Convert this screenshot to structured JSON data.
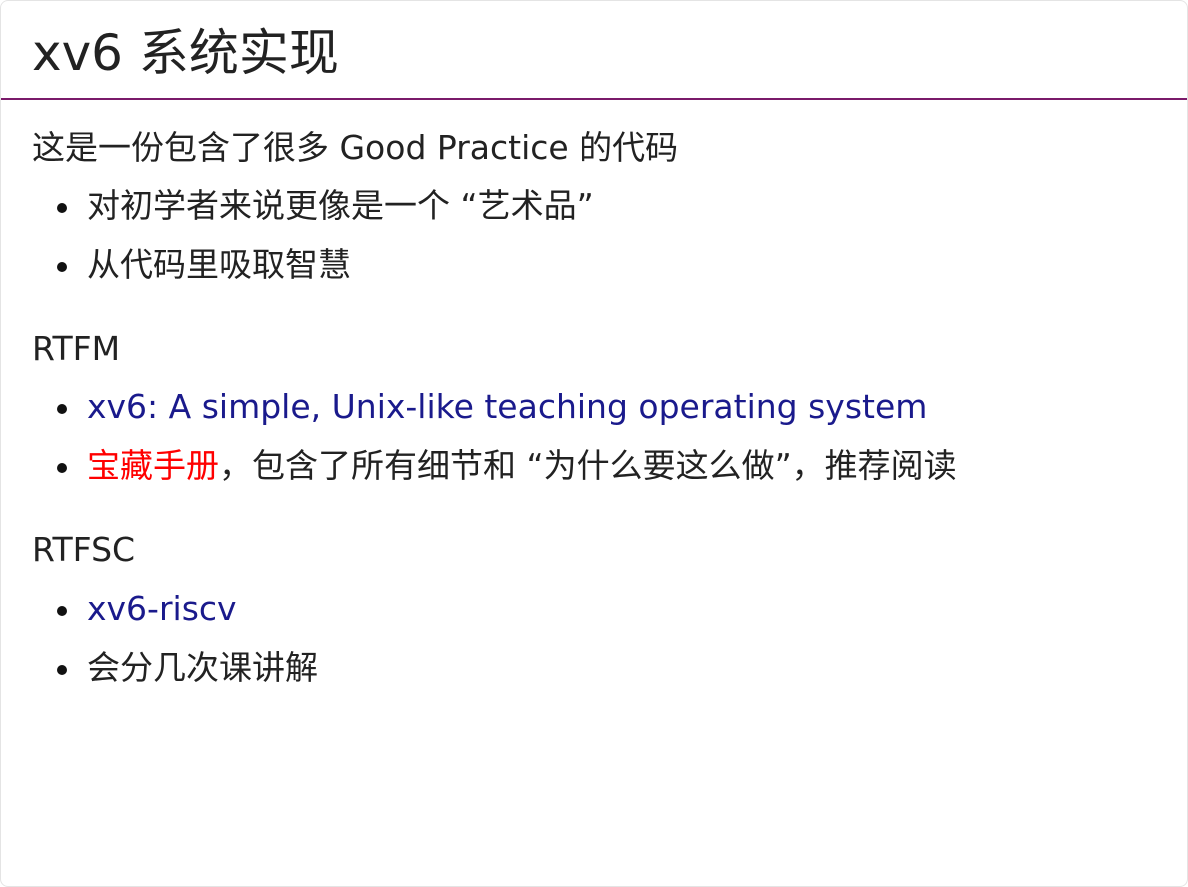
{
  "title": "xv6 系统实现",
  "intro": {
    "text": "这是一份包含了很多 Good Practice 的代码",
    "items": [
      "对初学者来说更像是一个 “艺术品”",
      "从代码里吸取智慧"
    ]
  },
  "rtfm": {
    "heading": "RTFM",
    "link_book": "xv6: A simple, Unix-like teaching operating system",
    "link_manual": "宝藏手册",
    "manual_rest": "，包含了所有细节和 “为什么要这么做”，推荐阅读"
  },
  "rtfsc": {
    "heading": "RTFSC",
    "link_repo": "xv6-riscv",
    "note": "会分几次课讲解"
  },
  "colors": {
    "title_rule": "#7a1a6a",
    "link": "#1a1a8c",
    "link_highlight": "#ff0000",
    "text": "#222222"
  }
}
